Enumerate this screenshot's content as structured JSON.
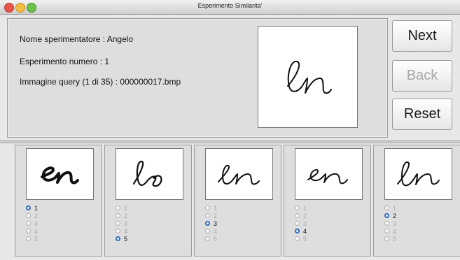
{
  "window": {
    "title": "Esperimento Similarita'"
  },
  "info": {
    "experimenter": "Nome sperimentatore : Angelo",
    "experiment": "Esperimento numero : 1",
    "query": "Immagine query (1 di 35) : 000000017.bmp"
  },
  "buttons": {
    "next": "Next",
    "back": "Back",
    "reset": "Reset"
  },
  "query_image": {
    "text": "en"
  },
  "candidates": [
    {
      "text": "en",
      "options": [
        "1",
        "2",
        "3",
        "4",
        "5"
      ],
      "selected": "1"
    },
    {
      "text": "ls",
      "options": [
        "1",
        "2",
        "3",
        "4",
        "5"
      ],
      "selected": "5"
    },
    {
      "text": "en",
      "options": [
        "1",
        "2",
        "3",
        "4",
        "5"
      ],
      "selected": "3"
    },
    {
      "text": "en",
      "options": [
        "1",
        "2",
        "3",
        "4",
        "5"
      ],
      "selected": "4"
    },
    {
      "text": "en",
      "options": [
        "1",
        "2",
        "3",
        "4",
        "5"
      ],
      "selected": "2"
    }
  ]
}
